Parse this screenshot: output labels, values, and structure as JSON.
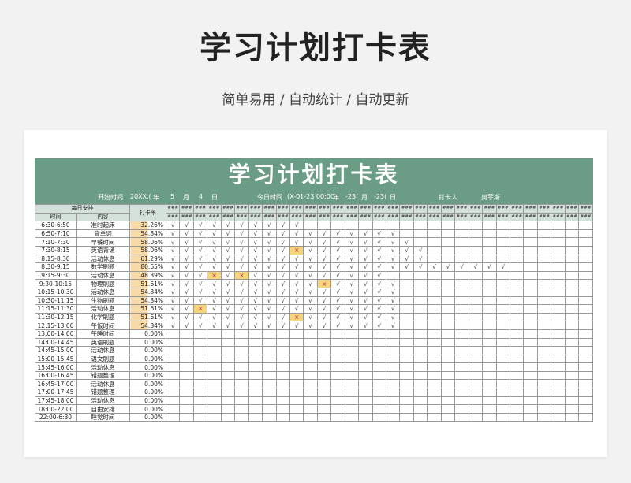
{
  "page": {
    "title": "学习计划打卡表",
    "subtitle": "简单易用 / 自动统计 / 自动更新"
  },
  "sheet": {
    "banner": "学习计划打卡表",
    "info": {
      "start_label": "开始时间",
      "start_year": "20XX.(",
      "year_unit": "年",
      "start_month": "5",
      "month_unit": "月",
      "start_day": "4",
      "day_unit": "日",
      "today_label": "今日时间",
      "today_value": "(X-01-23 00:0C",
      "today_year_unit": "年",
      "today_month": "-23(",
      "today_month_unit": "月",
      "today_day": "-23(",
      "today_day_unit": "日",
      "person_label": "打卡人",
      "person_name": "奥菲斯"
    },
    "header": {
      "group": "每日安排",
      "time": "时间",
      "task": "内容",
      "rate": "打卡率",
      "date_mask": "###"
    },
    "date_cols": 31,
    "rows": [
      {
        "time": "6:30-6:50",
        "task": "准时起床",
        "rate": "32.26%",
        "marks": "√√√√√√√√√√"
      },
      {
        "time": "6:50-7:10",
        "task": "背单词",
        "rate": "54.84%",
        "marks": "√√√√√√√√√√√√√√√√√"
      },
      {
        "time": "7:10-7:30",
        "task": "早餐时间",
        "rate": "58.06%",
        "marks": "√√√√√√√√√√√√√√√√√√"
      },
      {
        "time": "7:30-8:15",
        "task": "英语背诵",
        "rate": "58.06%",
        "marks": "√√√√√√√√√×√√√√√√√√√"
      },
      {
        "time": "8:15-8:30",
        "task": "活动休息",
        "rate": "61.29%",
        "marks": "√√√√√√√√√√√√√√√√√√√"
      },
      {
        "time": "8:30-9:15",
        "task": "数学刷题",
        "rate": "80.65%",
        "marks": "√√√√√√√√√√√√√√√√√√√√√√√√√"
      },
      {
        "time": "9:15-9:30",
        "task": "活动休息",
        "rate": "48.39%",
        "marks": "√√√×√×√√√√√√√√√√"
      },
      {
        "time": "9:30-10:15",
        "task": "物理刷题",
        "rate": "51.61%",
        "marks": "√√√√√√√√√√√×√√√√√"
      },
      {
        "time": "10:15-10:30",
        "task": "活动休息",
        "rate": "54.84%",
        "marks": "√√√√√√√√√√√√√√√√√"
      },
      {
        "time": "10:30-11:15",
        "task": "生物刷题",
        "rate": "54.84%",
        "marks": "√√√√√√√√√√√√√√√√√"
      },
      {
        "time": "11:15-11:30",
        "task": "活动休息",
        "rate": "51.61%",
        "marks": "√√×√√√√√√√√√√√√√√"
      },
      {
        "time": "11:30-12:15",
        "task": "化学刷题",
        "rate": "51.61%",
        "marks": "√√√√√√√√√×√√√√√√√"
      },
      {
        "time": "12:15-13:00",
        "task": "午饭时间",
        "rate": "54.84%",
        "marks": "√√√√√√√√√√√√√√√√√"
      },
      {
        "time": "13:00-14:00",
        "task": "午睡时间",
        "rate": "0.00%",
        "marks": ""
      },
      {
        "time": "14:00-14:45",
        "task": "英语刷题",
        "rate": "0.00%",
        "marks": ""
      },
      {
        "time": "14:45-15:00",
        "task": "活动休息",
        "rate": "0.00%",
        "marks": ""
      },
      {
        "time": "15:00-15:45",
        "task": "语文刷题",
        "rate": "0.00%",
        "marks": ""
      },
      {
        "time": "15:45-16:00",
        "task": "活动休息",
        "rate": "0.00%",
        "marks": ""
      },
      {
        "time": "16:00-16:45",
        "task": "错题整理",
        "rate": "0.00%",
        "marks": ""
      },
      {
        "time": "16:45-17:00",
        "task": "活动休息",
        "rate": "0.00%",
        "marks": ""
      },
      {
        "time": "17:00-17:45",
        "task": "错题整理",
        "rate": "0.00%",
        "marks": ""
      },
      {
        "time": "17:45-18:00",
        "task": "活动休息",
        "rate": "0.00%",
        "marks": ""
      },
      {
        "time": "18:00-22:00",
        "task": "自由安排",
        "rate": "0.00%",
        "marks": ""
      },
      {
        "time": "22:00-6:30",
        "task": "睡觉时间",
        "rate": "0.00%",
        "marks": ""
      }
    ]
  }
}
